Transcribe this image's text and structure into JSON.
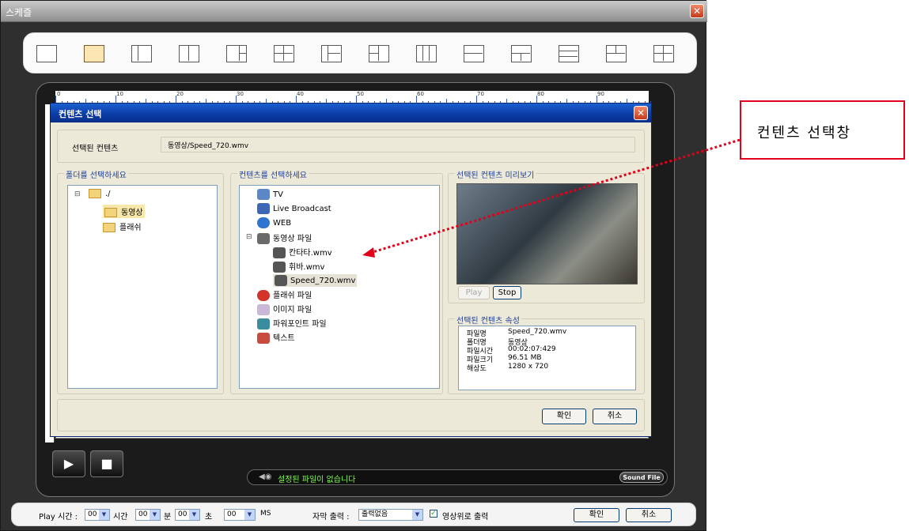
{
  "window": {
    "title": "스케즐"
  },
  "dialog": {
    "title": "컨텐츠 선택",
    "selected_label": "선택된 컨텐츠",
    "selected_value": "동영상/Speed_720.wmv",
    "folder_group": "폴더를 선택하세요",
    "content_group": "컨텐츠를 선택하세요",
    "preview_group": "선택된 컨텐츠 미리보기",
    "props_group": "선택된 컨텐츠 속성",
    "folders": {
      "root": "./",
      "items": [
        "동영상",
        "플래쉬"
      ]
    },
    "contents": {
      "items": [
        "TV",
        "Live Broadcast",
        "WEB",
        "동영상 파일"
      ],
      "video_files": [
        "칸타타.wmv",
        "휘바.wmv",
        "Speed_720.wmv"
      ],
      "more_items": [
        "플래쉬 파일",
        "이미지 파일",
        "파워포인트 파일",
        "텍스트"
      ]
    },
    "play_label": "Play",
    "stop_label": "Stop",
    "props": [
      {
        "key": "파일명",
        "value": "Speed_720.wmv"
      },
      {
        "key": "폴더명",
        "value": "동영상"
      },
      {
        "key": "파일시간",
        "value": "00:02:07:429"
      },
      {
        "key": "파일크기",
        "value": "96.51 MB"
      },
      {
        "key": "해상도",
        "value": "1280 x 720"
      }
    ],
    "ok_label": "확인",
    "cancel_label": "취소"
  },
  "ruler": {
    "labels": [
      "0",
      "10",
      "20",
      "30",
      "40",
      "50",
      "60",
      "70",
      "80",
      "90"
    ]
  },
  "status": {
    "text": "설정된 파일이 없습니다",
    "sound_label": "Sound File"
  },
  "bottom": {
    "play_time_label": "Play 시간 :",
    "hour_value": "00",
    "hour_unit": "시간",
    "min_value": "00",
    "min_unit": "분",
    "sec_value": "00",
    "sec_unit": "초",
    "ms_value": "00",
    "ms_unit": "MS",
    "subtitle_label": "자막 출력 :",
    "subtitle_value": "출력없음",
    "overlay_label": "영상위로 출력",
    "ok_label": "확인",
    "cancel_label": "취소"
  },
  "callout": {
    "text": "컨텐츠 선택창"
  }
}
